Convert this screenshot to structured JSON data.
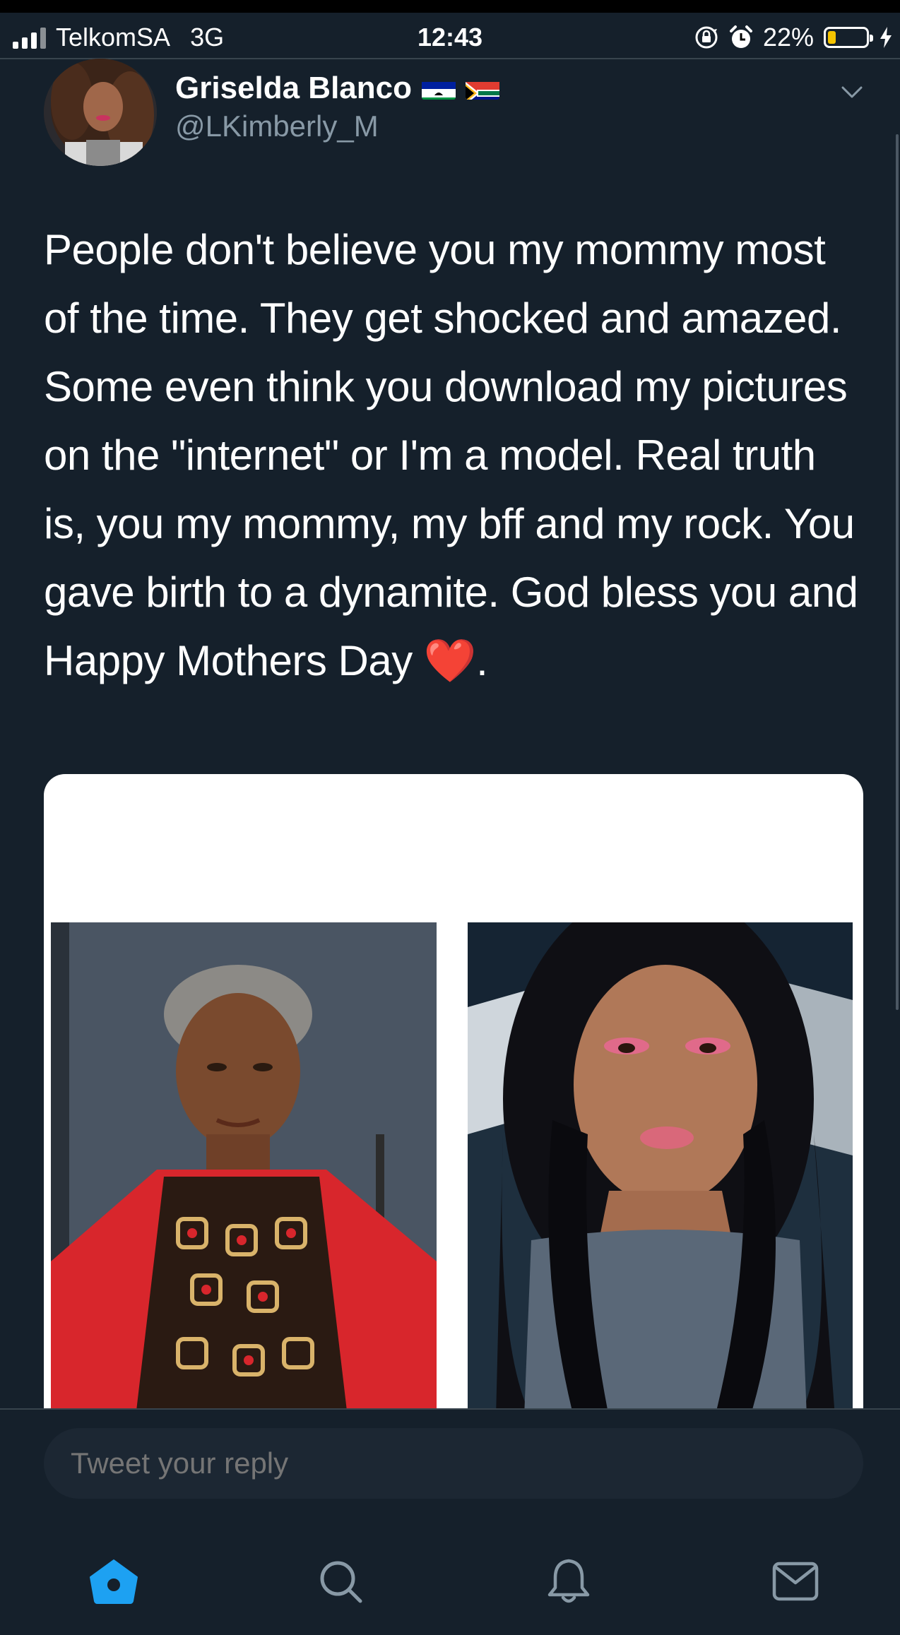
{
  "status_bar": {
    "carrier": "TelkomSA",
    "network": "3G",
    "time": "12:43",
    "battery_percent_label": "22%",
    "battery_level": 0.22,
    "icons": [
      "signal-icon",
      "orientation-lock-icon",
      "alarm-icon",
      "battery-icon",
      "charging-icon"
    ]
  },
  "tweet": {
    "display_name": "Griselda Blanco",
    "handle": "@LKimberly_M",
    "flags": [
      "lesotho-flag-icon",
      "south-africa-flag-icon"
    ],
    "text": "People don't believe you my mommy most of the time. They get shocked and amazed. Some even think you download my pictures on the \"internet\" or I'm a model. Real truth is, you my mommy, my bff and my rock. You gave birth to a dynamite. God bless you and Happy Mothers Day ❤️.",
    "media": [
      "older-woman-photo",
      "young-woman-selfie-photo"
    ]
  },
  "reply": {
    "placeholder": "Tweet your reply"
  },
  "tabbar": {
    "items": [
      "home-icon",
      "search-icon",
      "notifications-icon",
      "messages-icon"
    ],
    "accent": "#1da1f2",
    "inactive": "#8899a6"
  },
  "colors": {
    "background": "#15202b",
    "secondary_text": "#8899a6",
    "divider": "#38444d"
  }
}
